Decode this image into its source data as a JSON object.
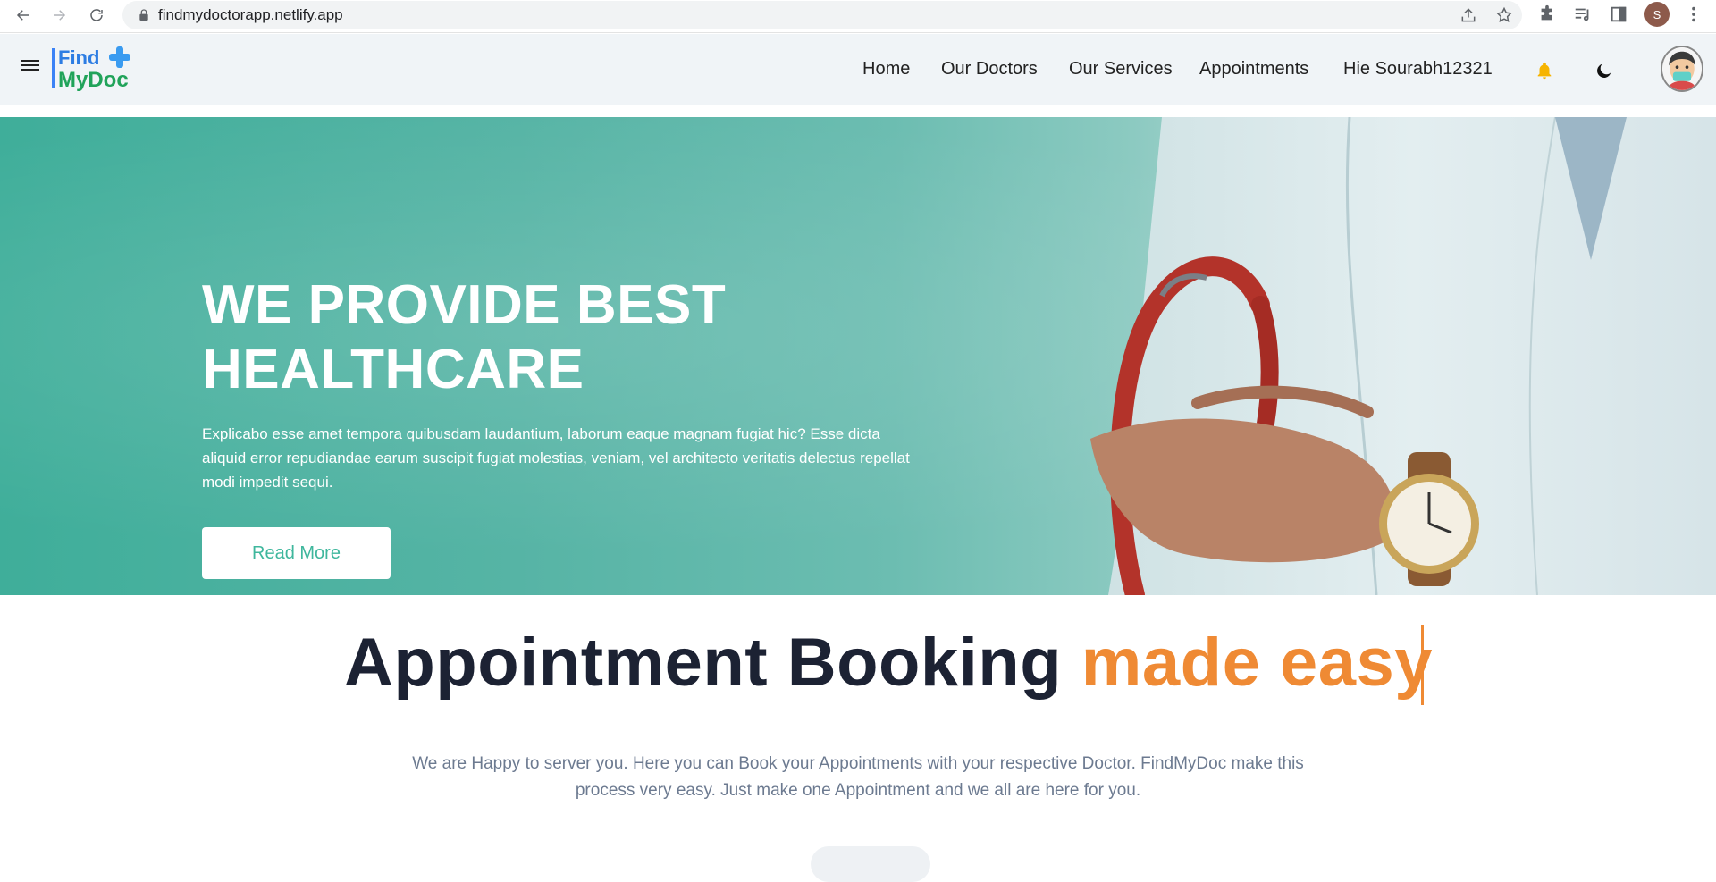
{
  "browser": {
    "url": "findmydoctorapp.netlify.app",
    "profile_initial": "S"
  },
  "nav": {
    "logo_line1": "Find",
    "logo_line2": "MyDoc",
    "links": [
      "Home",
      "Our Doctors",
      "Our Services",
      "Appointments"
    ],
    "greeting": "Hie Sourabh12321"
  },
  "hero": {
    "title": "WE PROVIDE BEST HEALTHCARE",
    "description": "Explicabo esse amet tempora quibusdam laudantium, laborum eaque magnam fugiat hic? Esse dicta aliquid error repudiandae earum suscipit fugiat molestias, veniam, vel architecto veritatis delectus repellat modi impedit sequi.",
    "button_label": "Read More"
  },
  "appointment": {
    "title_main": "Appointment Booking",
    "title_accent": "made easy",
    "description": "We are Happy to server you. Here you can Book your Appointments with your respective Doctor. FindMyDoc make this process very easy. Just make one Appointment and we all are here for you."
  },
  "colors": {
    "accent_orange": "#ef8a34",
    "hero_teal": "#3fae9a",
    "bell_yellow": "#f6b400"
  }
}
